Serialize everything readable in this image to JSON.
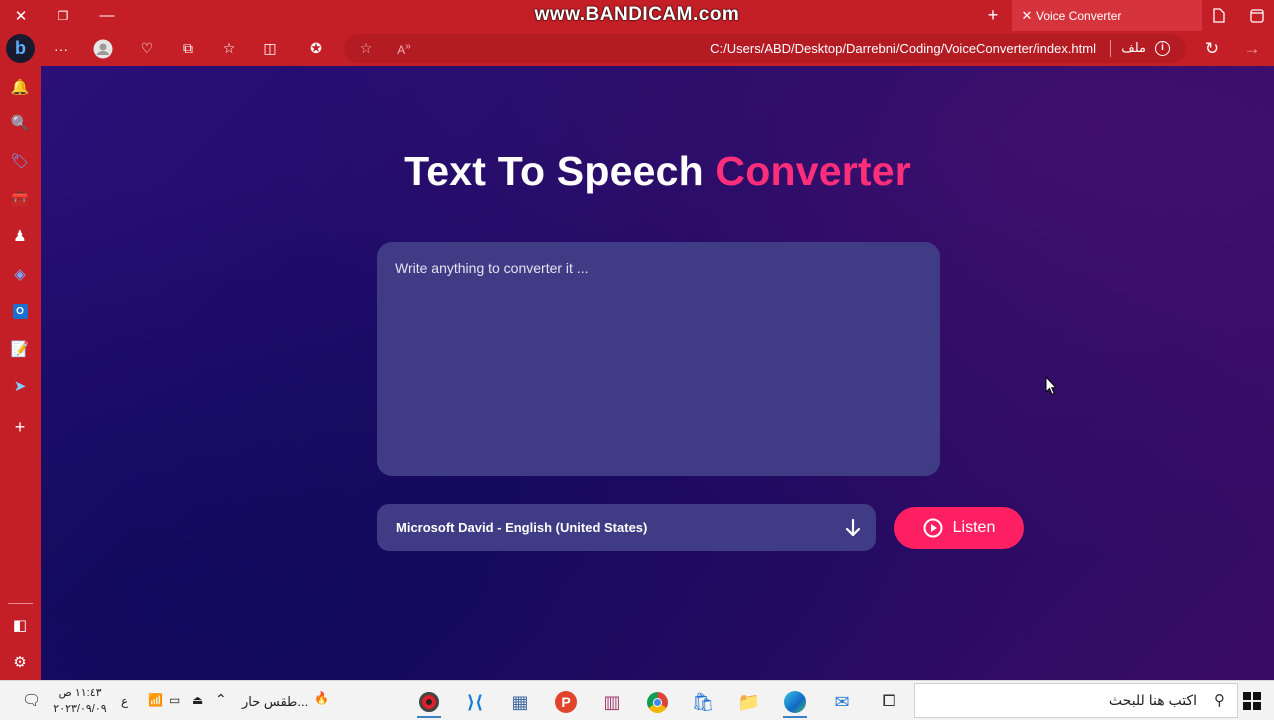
{
  "browser": {
    "watermark": "www.BANDICAM.com",
    "tab_title": "Voice Converter",
    "address_url": "C:/Users/ABD/Desktop/Darrebni/Coding/VoiceConverter/index.html",
    "address_scheme_label": "ملف"
  },
  "page": {
    "title_main": "Text To Speech ",
    "title_accent": "Converter",
    "textarea_placeholder": "Write anything to converter it ...",
    "voice_selected": "Microsoft David - English (United States)",
    "listen_label": "Listen"
  },
  "taskbar": {
    "search_placeholder": "اكتب هنا للبحث",
    "weather": "طقس حار...",
    "time": "١١:٤٣ ص",
    "date": "٢٠٢٣/٠٩/٠٩",
    "lang": "ع"
  },
  "colors": {
    "chrome": "#c41f27",
    "accent": "#ff2e7a",
    "listen_button": "#ff2063",
    "panel": "#3f3b84"
  }
}
